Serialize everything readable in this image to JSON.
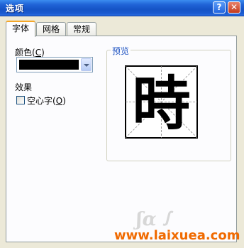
{
  "window": {
    "title": "选项"
  },
  "tabs": [
    {
      "label": "字体",
      "active": true
    },
    {
      "label": "网格",
      "active": false
    },
    {
      "label": "常规",
      "active": false
    }
  ],
  "font_tab": {
    "color_label": "颜色(",
    "color_key": "C",
    "color_label_end": ")",
    "color_value": "#000000",
    "effects_label": "效果",
    "hollow_label": "空心字(",
    "hollow_key": "O",
    "hollow_label_end": ")",
    "hollow_checked": false
  },
  "preview": {
    "label": "预览",
    "character": "時"
  },
  "watermark": {
    "url": "www.laixuea.com"
  },
  "colors": {
    "title_bar": "#1553c6",
    "watermark": "#f06a00",
    "group_label": "#2054c2"
  }
}
